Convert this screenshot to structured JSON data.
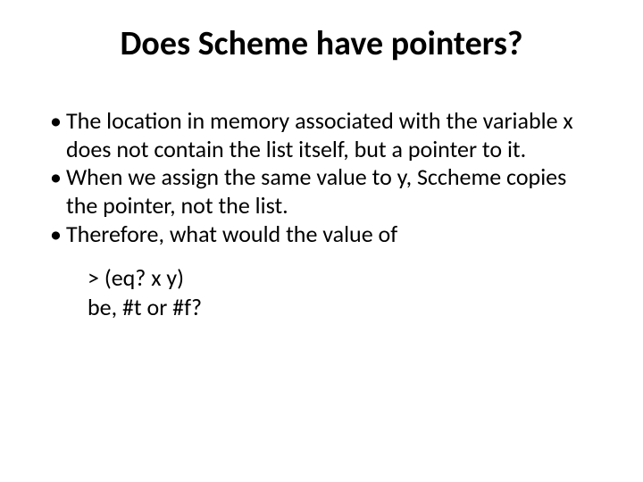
{
  "title": "Does Scheme have pointers?",
  "bullets": [
    "The location in memory associated with the variable x does not contain the list itself, but a pointer to it.",
    "When we assign the same value to y, Sccheme copies the pointer, not the list.",
    "Therefore,  what would the value of"
  ],
  "code_lines": [
    ">  (eq?  x  y)",
    "be,  #t or #f?"
  ]
}
